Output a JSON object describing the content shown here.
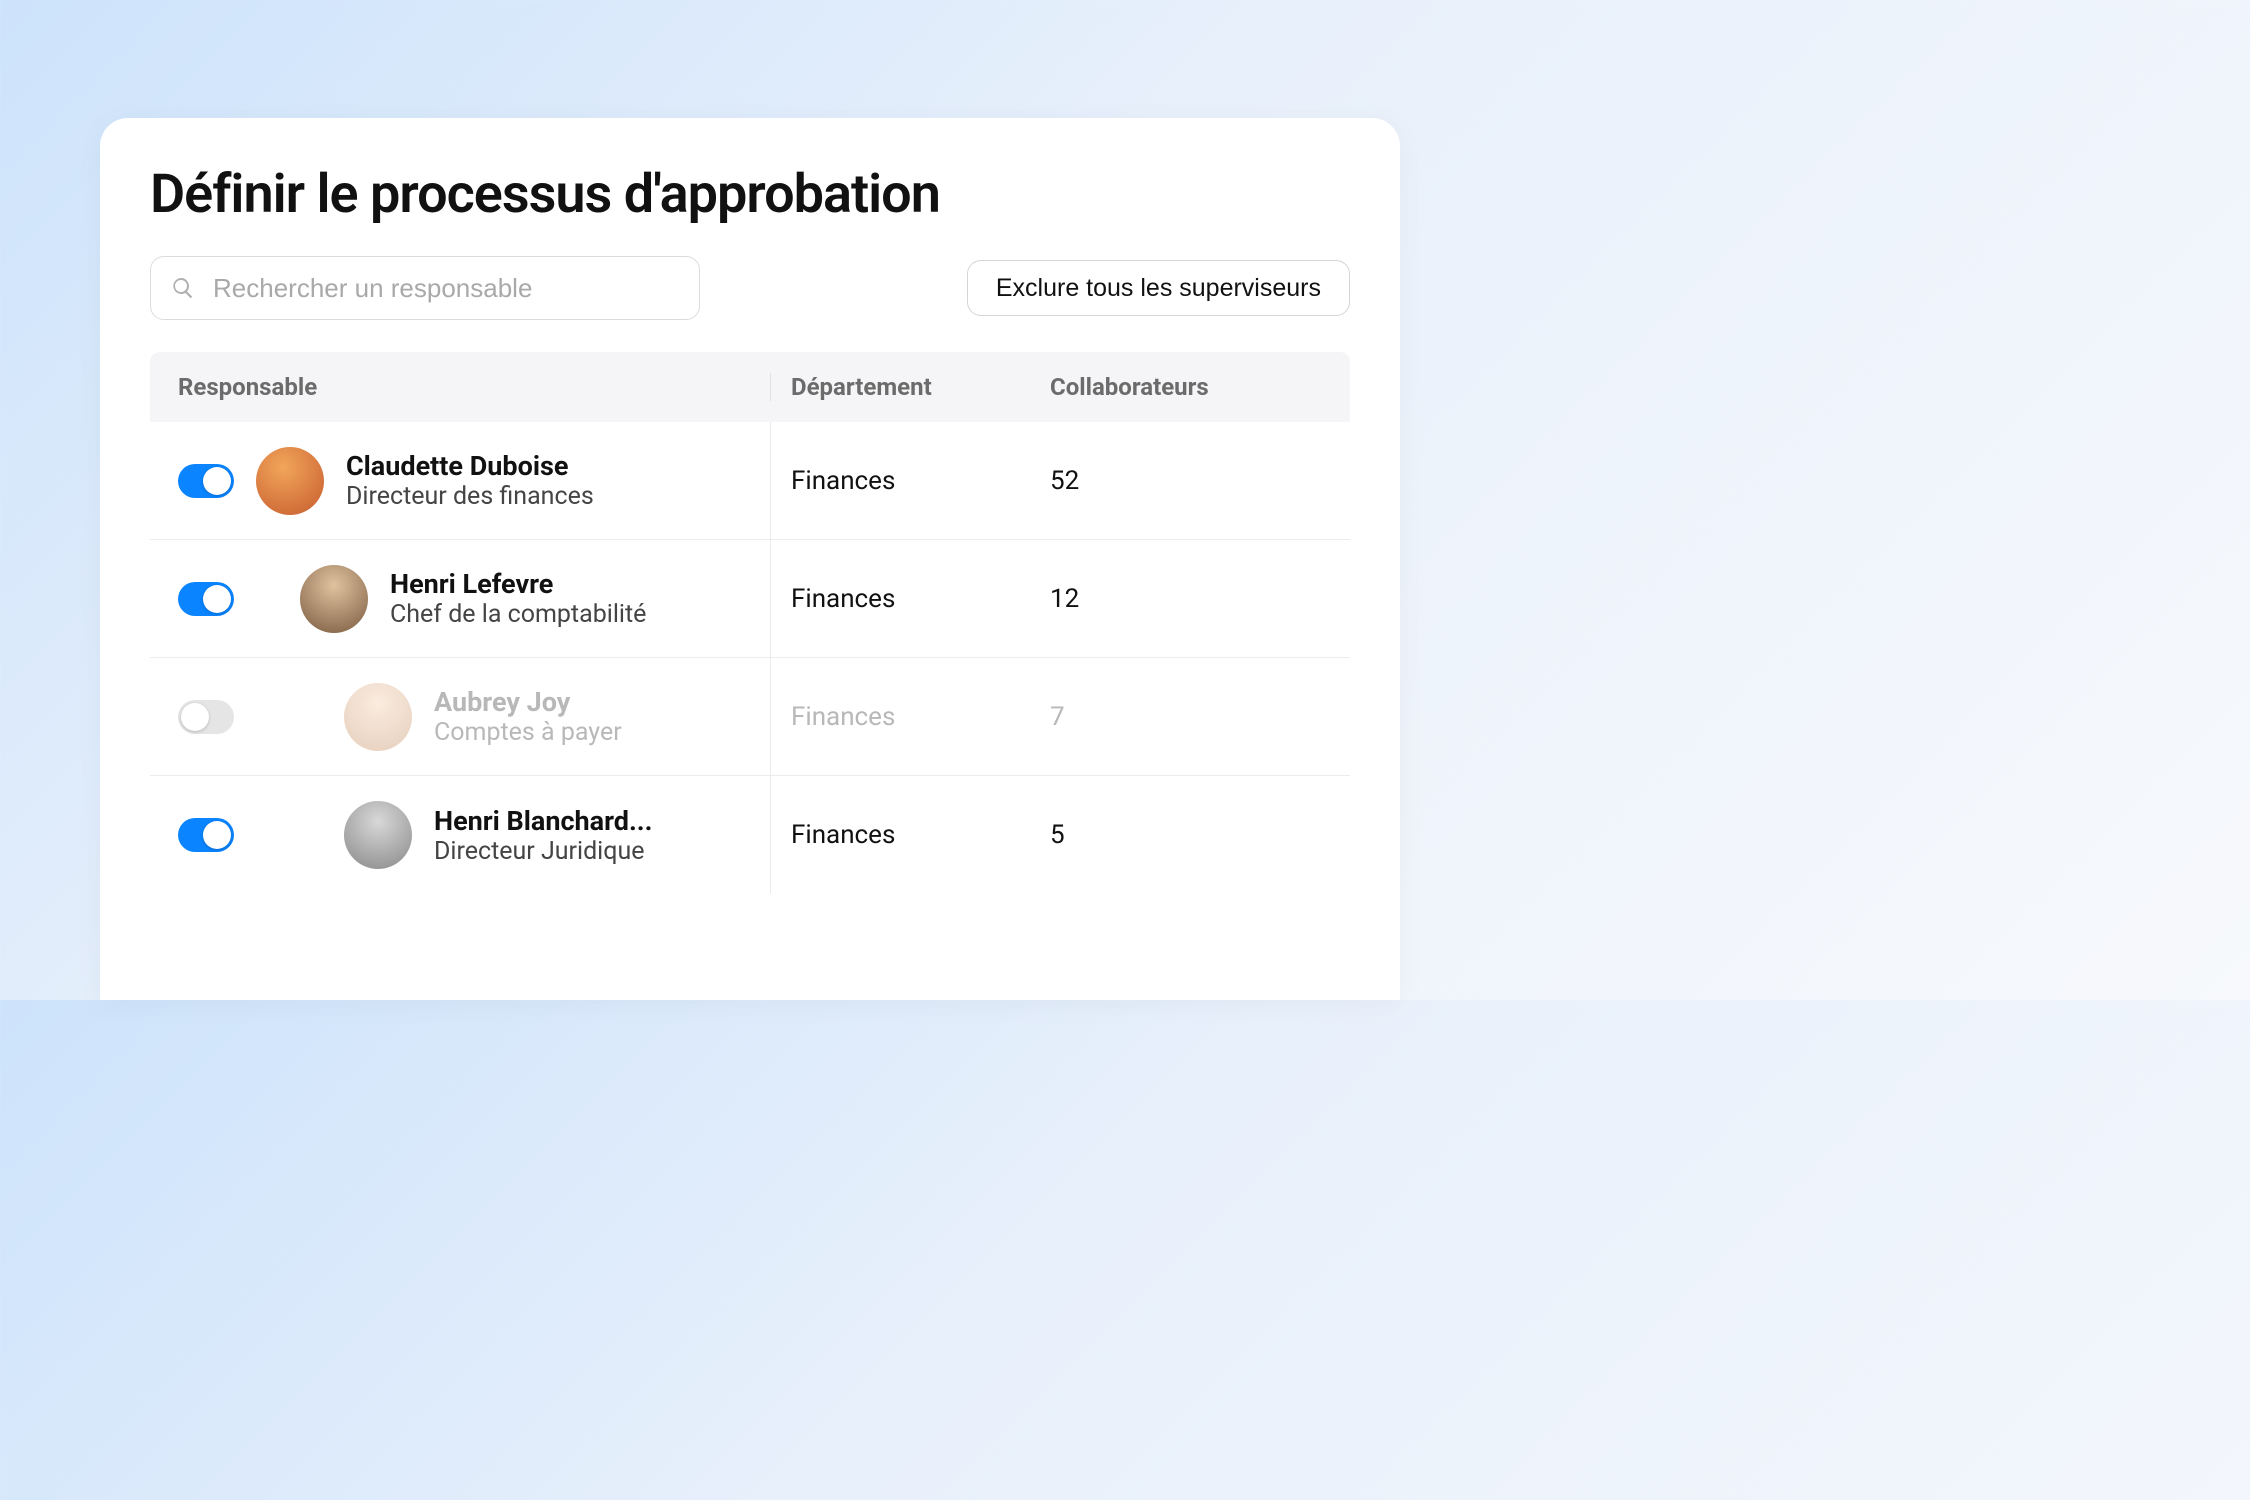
{
  "title": "Définir le processus d'approbation",
  "search": {
    "placeholder": "Rechercher un responsable"
  },
  "actions": {
    "exclude_all_label": "Exclure tous les superviseurs"
  },
  "columns": {
    "person": "Responsable",
    "department": "Département",
    "collaborators": "Collaborateurs"
  },
  "rows": [
    {
      "enabled": true,
      "indent": 1,
      "name": "Claudette Duboise",
      "role": "Directeur des finances",
      "department": "Finances",
      "collaborators": "52"
    },
    {
      "enabled": true,
      "indent": 2,
      "name": "Henri Lefevre",
      "role": "Chef de la comptabilité",
      "department": "Finances",
      "collaborators": "12"
    },
    {
      "enabled": false,
      "indent": 3,
      "name": "Aubrey Joy",
      "role": "Comptes à payer",
      "department": "Finances",
      "collaborators": "7"
    },
    {
      "enabled": true,
      "indent": 3,
      "name": "Henri Blanchard...",
      "role": "Directeur Juridique",
      "department": "Finances",
      "collaborators": "5"
    }
  ]
}
